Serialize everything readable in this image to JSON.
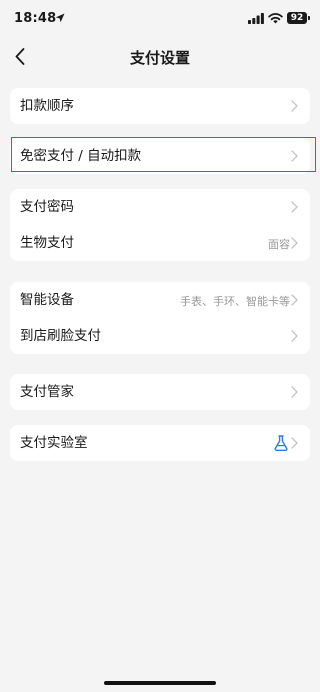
{
  "status_bar": {
    "time": "18:48",
    "battery": "92"
  },
  "nav": {
    "title": "支付设置"
  },
  "groups": [
    {
      "rows": [
        {
          "label": "扣款顺序"
        }
      ]
    },
    {
      "rows": [
        {
          "label": "免密支付 / 自动扣款"
        }
      ]
    },
    {
      "rows": [
        {
          "label": "支付密码"
        },
        {
          "label": "生物支付",
          "value": "面容"
        }
      ]
    },
    {
      "rows": [
        {
          "label": "智能设备",
          "value": "手表、手环、智能卡等"
        },
        {
          "label": "到店刷脸支付"
        }
      ]
    },
    {
      "rows": [
        {
          "label": "支付管家"
        }
      ]
    },
    {
      "rows": [
        {
          "label": "支付实验室",
          "icon": "flask-icon"
        }
      ]
    }
  ],
  "colors": {
    "background": "#f4f4f5",
    "card": "#ffffff",
    "highlight": "#e0343c",
    "flask": "#2f7be5",
    "chevron": "#c4c4c4"
  }
}
